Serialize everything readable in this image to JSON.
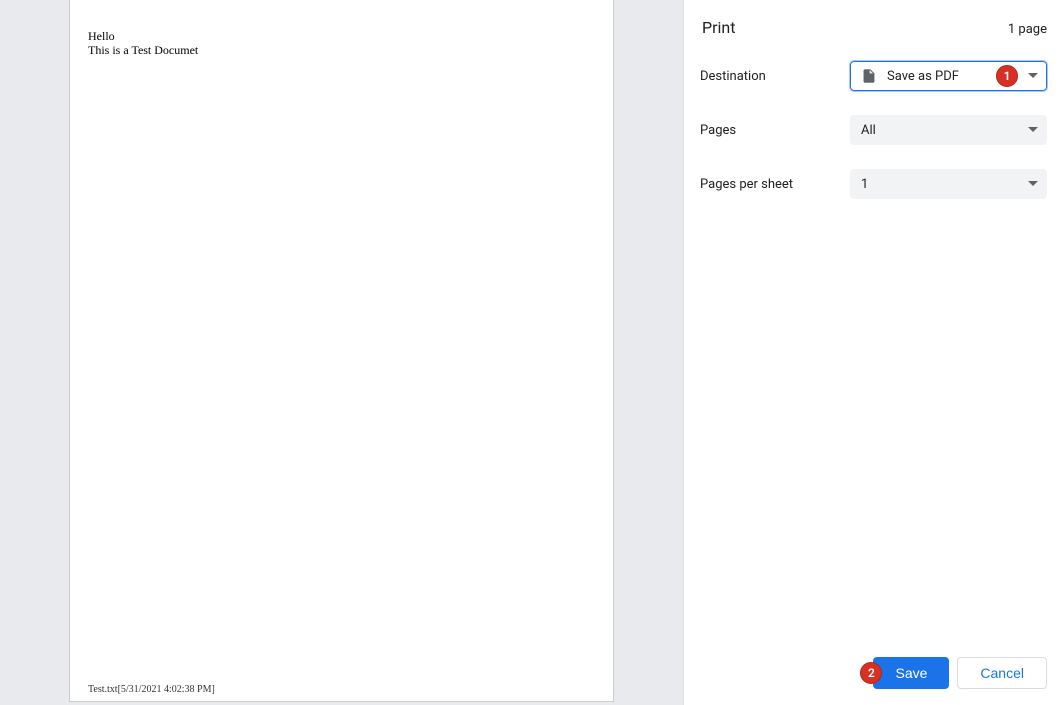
{
  "preview": {
    "line1": "Hello",
    "line2": "This is a Test Documet",
    "footer": "Test.txt[5/31/2021 4:02:38 PM]"
  },
  "header": {
    "title": "Print",
    "page_count": "1 page"
  },
  "settings": {
    "destination": {
      "label": "Destination",
      "value": "Save as PDF"
    },
    "pages": {
      "label": "Pages",
      "value": "All"
    },
    "pages_per_sheet": {
      "label": "Pages per sheet",
      "value": "1"
    }
  },
  "buttons": {
    "save": "Save",
    "cancel": "Cancel"
  },
  "annotations": {
    "badge1": "1",
    "badge2": "2"
  }
}
